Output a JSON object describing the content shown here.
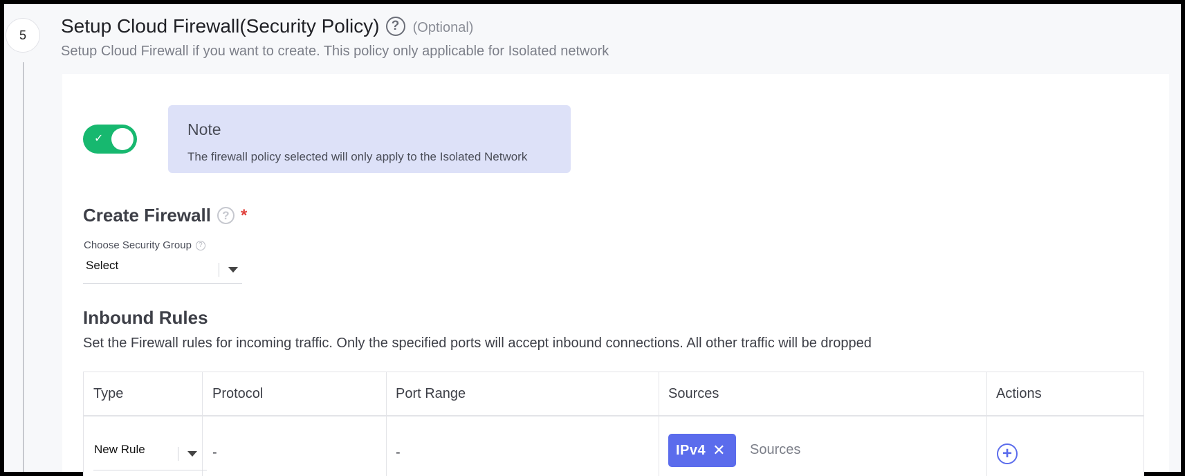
{
  "step": {
    "number": "5"
  },
  "header": {
    "title": "Setup Cloud Firewall(Security Policy)",
    "optional": "(Optional)",
    "subtitle": "Setup Cloud Firewall if you want to create. This policy only applicable for Isolated network"
  },
  "toggle": {
    "enabled": true,
    "icon": "check-icon"
  },
  "note": {
    "title": "Note",
    "text": "The firewall policy selected will only apply to the Isolated Network"
  },
  "create_firewall": {
    "title": "Create Firewall",
    "required_mark": "*",
    "security_group_label": "Choose Security Group",
    "security_group_value": "Select"
  },
  "inbound": {
    "title": "Inbound Rules",
    "description": "Set the Firewall rules for incoming traffic. Only the specified ports will accept inbound connections. All other traffic will be dropped",
    "columns": [
      "Type",
      "Protocol",
      "Port Range",
      "Sources",
      "Actions"
    ],
    "rows": [
      {
        "type": "New Rule",
        "protocol": "-",
        "port_range": "-",
        "source_chip": "IPv4",
        "sources_placeholder": "Sources"
      }
    ]
  },
  "colors": {
    "toggle_on": "#17b86f",
    "note_bg": "#dde1f8",
    "chip_bg": "#5b6cec",
    "required": "#e0413c"
  }
}
